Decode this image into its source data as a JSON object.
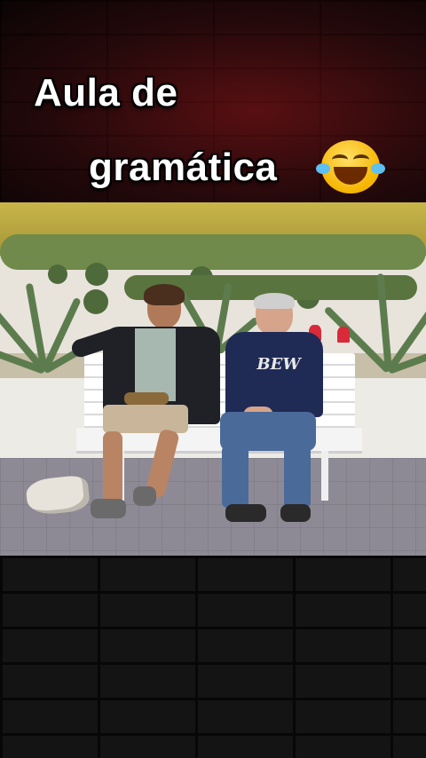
{
  "caption": {
    "line1": "Aula de",
    "line2": "gramática"
  },
  "sweater_text": "BEW",
  "emoji_name": "tears-of-joy-emoji",
  "colors": {
    "caption_text": "#ffffff",
    "top_brick": "#4a0d10",
    "bottom_brick": "#141414",
    "bench": "#f4f4f4"
  }
}
